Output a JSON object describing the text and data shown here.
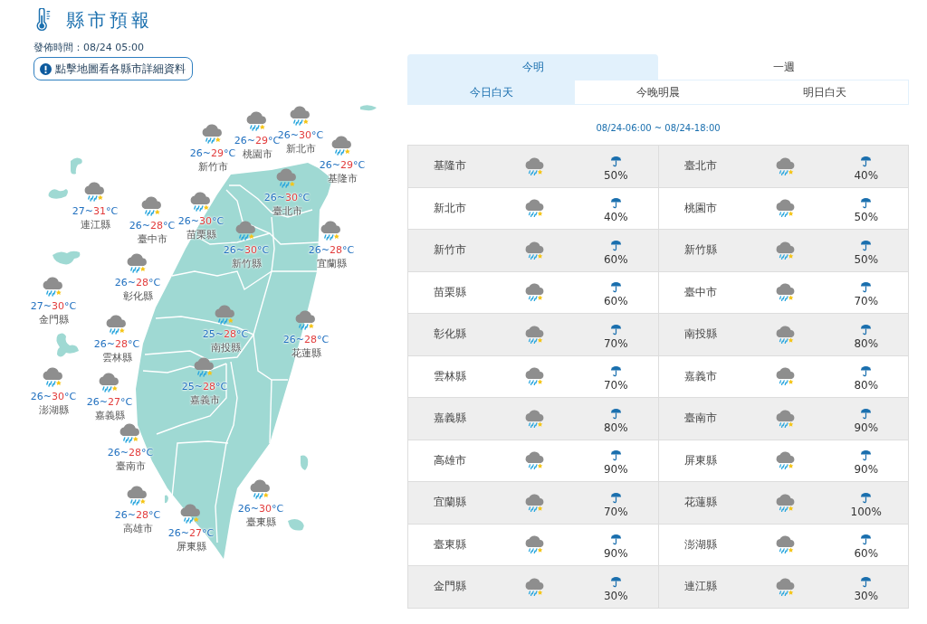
{
  "header": {
    "title": "縣市預報",
    "issued": "發佈時間：08/24 05:00",
    "map_hint_button": "點擊地圖看各縣市詳細資料"
  },
  "map": {
    "markers": [
      {
        "name": "新竹市",
        "low": "26",
        "sep": "~",
        "high": "29",
        "unit": "°C"
      },
      {
        "name": "桃園市",
        "low": "26",
        "sep": "~",
        "high": "29",
        "unit": "°C"
      },
      {
        "name": "新北市",
        "low": "26",
        "sep": "~",
        "high": "30",
        "unit": "°C"
      },
      {
        "name": "基隆市",
        "low": "26",
        "sep": "~",
        "high": "29",
        "unit": "°C"
      },
      {
        "name": "臺北市",
        "low": "26",
        "sep": "~",
        "high": "30",
        "unit": "°C"
      },
      {
        "name": "連江縣",
        "low": "27",
        "sep": "~",
        "high": "31",
        "unit": "°C"
      },
      {
        "name": "臺中市",
        "low": "26",
        "sep": "~",
        "high": "28",
        "unit": "°C"
      },
      {
        "name": "苗栗縣",
        "low": "26",
        "sep": "~",
        "high": "30",
        "unit": "°C"
      },
      {
        "name": "新竹縣",
        "low": "26",
        "sep": "~",
        "high": "30",
        "unit": "°C"
      },
      {
        "name": "宜蘭縣",
        "low": "26",
        "sep": "~",
        "high": "28",
        "unit": "°C"
      },
      {
        "name": "金門縣",
        "low": "27",
        "sep": "~",
        "high": "30",
        "unit": "°C"
      },
      {
        "name": "彰化縣",
        "low": "26",
        "sep": "~",
        "high": "28",
        "unit": "°C"
      },
      {
        "name": "雲林縣",
        "low": "26",
        "sep": "~",
        "high": "28",
        "unit": "°C"
      },
      {
        "name": "南投縣",
        "low": "25",
        "sep": "~",
        "high": "28",
        "unit": "°C"
      },
      {
        "name": "花蓮縣",
        "low": "26",
        "sep": "~",
        "high": "28",
        "unit": "°C"
      },
      {
        "name": "澎湖縣",
        "low": "26",
        "sep": "~",
        "high": "30",
        "unit": "°C"
      },
      {
        "name": "嘉義縣",
        "low": "26",
        "sep": "~",
        "high": "27",
        "unit": "°C"
      },
      {
        "name": "嘉義市",
        "low": "25",
        "sep": "~",
        "high": "28",
        "unit": "°C"
      },
      {
        "name": "臺南市",
        "low": "26",
        "sep": "~",
        "high": "28",
        "unit": "°C"
      },
      {
        "name": "高雄市",
        "low": "26",
        "sep": "~",
        "high": "28",
        "unit": "°C"
      },
      {
        "name": "屏東縣",
        "low": "26",
        "sep": "~",
        "high": "27",
        "unit": "°C"
      },
      {
        "name": "臺東縣",
        "low": "26",
        "sep": "~",
        "high": "30",
        "unit": "°C"
      }
    ]
  },
  "tabs": [
    {
      "label": "今明",
      "selected": true
    },
    {
      "label": "一週",
      "selected": false
    }
  ],
  "subtabs": [
    {
      "label": "今日白天",
      "selected": true
    },
    {
      "label": "今晚明晨",
      "selected": false
    },
    {
      "label": "明日白天",
      "selected": false
    }
  ],
  "period": "08/24-06:00 ~ 08/24-18:00",
  "table": {
    "rows": [
      {
        "cells": [
          {
            "county": "基隆市",
            "pop": "50%"
          },
          {
            "county": "臺北市",
            "pop": "40%"
          }
        ]
      },
      {
        "cells": [
          {
            "county": "新北市",
            "pop": "40%"
          },
          {
            "county": "桃園市",
            "pop": "50%"
          }
        ]
      },
      {
        "cells": [
          {
            "county": "新竹市",
            "pop": "60%"
          },
          {
            "county": "新竹縣",
            "pop": "50%"
          }
        ]
      },
      {
        "cells": [
          {
            "county": "苗栗縣",
            "pop": "60%"
          },
          {
            "county": "臺中市",
            "pop": "70%"
          }
        ]
      },
      {
        "cells": [
          {
            "county": "彰化縣",
            "pop": "70%"
          },
          {
            "county": "南投縣",
            "pop": "80%"
          }
        ]
      },
      {
        "cells": [
          {
            "county": "雲林縣",
            "pop": "70%"
          },
          {
            "county": "嘉義市",
            "pop": "80%"
          }
        ]
      },
      {
        "cells": [
          {
            "county": "嘉義縣",
            "pop": "80%"
          },
          {
            "county": "臺南市",
            "pop": "90%"
          }
        ]
      },
      {
        "cells": [
          {
            "county": "高雄市",
            "pop": "90%"
          },
          {
            "county": "屏東縣",
            "pop": "90%"
          }
        ]
      },
      {
        "cells": [
          {
            "county": "宜蘭縣",
            "pop": "70%"
          },
          {
            "county": "花蓮縣",
            "pop": "100%"
          }
        ]
      },
      {
        "cells": [
          {
            "county": "臺東縣",
            "pop": "90%"
          },
          {
            "county": "澎湖縣",
            "pop": "60%"
          }
        ]
      },
      {
        "cells": [
          {
            "county": "金門縣",
            "pop": "30%"
          },
          {
            "county": "連江縣",
            "pop": "30%"
          }
        ]
      }
    ]
  }
}
